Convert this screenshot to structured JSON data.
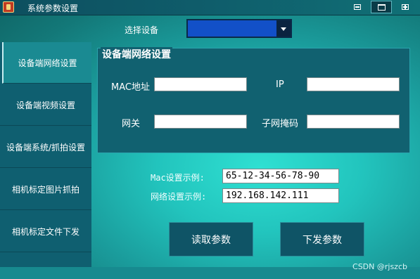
{
  "window": {
    "title": "系统参数设置"
  },
  "device_select": {
    "label": "选择设备",
    "value": ""
  },
  "sidebar": {
    "items": [
      {
        "label": "设备端网络设置",
        "active": true
      },
      {
        "label": "设备端视频设置",
        "active": false
      },
      {
        "label": "设备端系统/抓拍设置",
        "active": false
      },
      {
        "label": "相机标定图片抓拍",
        "active": false
      },
      {
        "label": "相机标定文件下发",
        "active": false
      }
    ]
  },
  "network_group": {
    "title": "设备端网络设置",
    "fields": {
      "mac": {
        "label": "MAC地址",
        "value": ""
      },
      "ip": {
        "label": "IP",
        "value": ""
      },
      "gateway": {
        "label": "网关",
        "value": ""
      },
      "subnet": {
        "label": "子网掩码",
        "value": ""
      }
    }
  },
  "examples": {
    "mac": {
      "label": "Mac设置示例:",
      "value": "65-12-34-56-78-90"
    },
    "network": {
      "label": "网络设置示例:",
      "value": "192.168.142.111"
    }
  },
  "actions": {
    "read_label": "读取参数",
    "send_label": "下发参数"
  },
  "watermark": "CSDN @rjszcb",
  "colors": {
    "background": "#22c4bd",
    "panel": "#116170",
    "titlebar": "#0f5d6b",
    "select_fill": "#1250c8"
  }
}
